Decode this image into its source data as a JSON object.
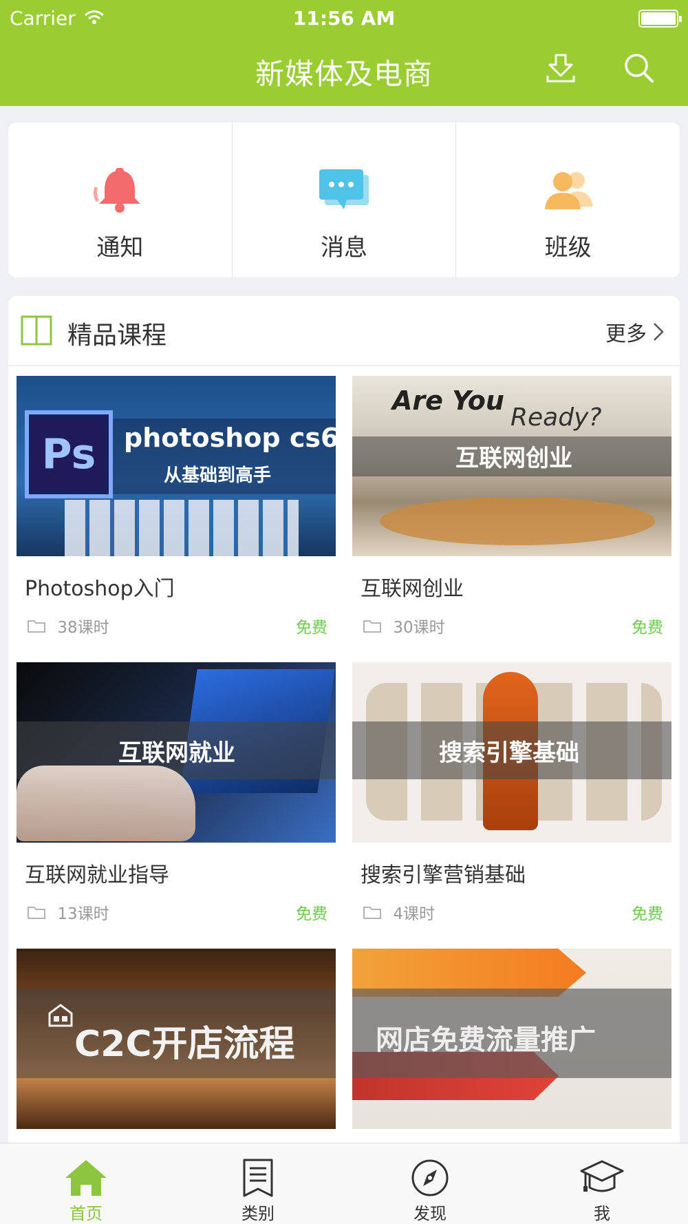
{
  "status_bar": {
    "carrier": "Carrier",
    "time": "11:56 AM"
  },
  "header": {
    "title": "新媒体及电商",
    "icons": [
      "download-icon",
      "search-icon"
    ]
  },
  "quick_menu": [
    {
      "label": "通知",
      "icon": "bell-icon",
      "color": "#f46b6b"
    },
    {
      "label": "消息",
      "icon": "message-icon",
      "color": "#4fc3e8"
    },
    {
      "label": "班级",
      "icon": "class-icon",
      "color": "#f7b85f"
    }
  ],
  "courses_section": {
    "title": "精品课程",
    "more": "更多",
    "courses": [
      {
        "name": "Photoshop入门",
        "lessons": "38课时",
        "price": "免费",
        "thumb_line1": "photoshop cs6",
        "thumb_line2": "从基础到高手",
        "thumb_badge": "Ps"
      },
      {
        "name": "互联网创业",
        "lessons": "30课时",
        "price": "免费",
        "thumb_line1": "Are You",
        "thumb_line2": "Ready?",
        "thumb_band": "互联网创业"
      },
      {
        "name": "互联网就业指导",
        "lessons": "13课时",
        "price": "免费",
        "thumb_band": "互联网就业"
      },
      {
        "name": "搜索引擎营销基础",
        "lessons": "4课时",
        "price": "免费",
        "thumb_band": "搜索引擎基础"
      },
      {
        "thumb_band": "C2C开店流程"
      },
      {
        "thumb_band": "网店免费流量推广"
      }
    ]
  },
  "tabbar": [
    {
      "label": "首页",
      "icon": "home-icon",
      "active": true
    },
    {
      "label": "类别",
      "icon": "category-icon",
      "active": false
    },
    {
      "label": "发现",
      "icon": "compass-icon",
      "active": false
    },
    {
      "label": "我",
      "icon": "graduation-cap-icon",
      "active": false
    }
  ],
  "colors": {
    "accent": "#9acd32",
    "free": "#6dcd4a",
    "active_tab": "#8cc63f"
  }
}
